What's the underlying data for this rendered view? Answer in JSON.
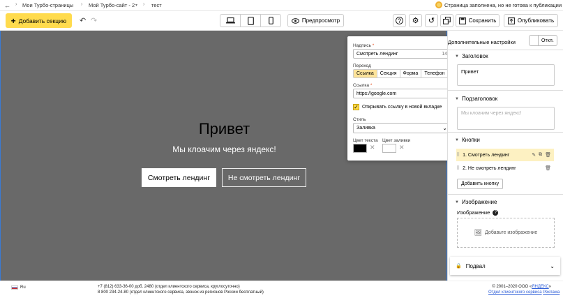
{
  "topbar": {
    "crumbs": [
      "Мои Турбо-страницы",
      "Мой Турбо-сайт - 2",
      "тест"
    ],
    "status": "Страница заполнена, но не готова к публикации"
  },
  "toolbar": {
    "add_section": "Добавить секцию",
    "preview": "Предпросмотр",
    "save": "Сохранить",
    "publish": "Опубликовать"
  },
  "canvas": {
    "title": "Привет",
    "subtitle": "Мы клоачим через яндекс!",
    "buttons": [
      "Смотреть лендинг",
      "Не смотреть лендинг"
    ]
  },
  "popover": {
    "caption_label": "Надпись",
    "caption_value": "Смотреть лендинг",
    "caption_count": "14",
    "transition_label": "Переход",
    "transition_options": [
      "Ссылка",
      "Секция",
      "Форма",
      "Телефон"
    ],
    "transition_selected": "Ссылка",
    "link_label": "Ссылка",
    "link_value": "https://google.com",
    "new_tab_label": "Открывать ссылку в новой вкладке",
    "new_tab_checked": true,
    "style_label": "Стиль",
    "style_value": "Заливка",
    "text_color_label": "Цвет текста",
    "text_color": "#000000",
    "fill_color_label": "Цвет заливки",
    "fill_color": "#ffffff"
  },
  "panel": {
    "extra_settings": "Дополнительные настройки",
    "toggle_label": "Откл.",
    "heading_section": "Заголовок",
    "heading_value": "Привет",
    "subheading_section": "Подзаголовок",
    "subheading_placeholder": "Мы клоачим через яндекс!",
    "buttons_section": "Кнопки",
    "button_items": [
      "1.  Смотреть лендинг",
      "2.  Не смотреть лендинг"
    ],
    "add_button": "Добавить кнопку",
    "image_section": "Изображение",
    "image_label": "Изображение",
    "add_image": "Добавьте изображение",
    "footer_section": "Подвал"
  },
  "footer": {
    "lang": "Ru",
    "phone1": "+7 (812) 633-36-00 доб. 2480 (отдел клиентского сервиса, круглосуточно)",
    "phone2": "8 800 234-24-80 (отдел клиентского сервиса, звонок из регионов России бесплатный)",
    "copyright": "© 2001–2020 ООО «",
    "yandex": "ЯНДЕКС",
    "copyright_end": "»",
    "support": "Отдел клиентского сервиса",
    "ads": "Реклама"
  },
  "colors": {
    "accent": "#ffdb4d",
    "canvas_bg": "#696969",
    "selection": "#3a7bd5"
  }
}
